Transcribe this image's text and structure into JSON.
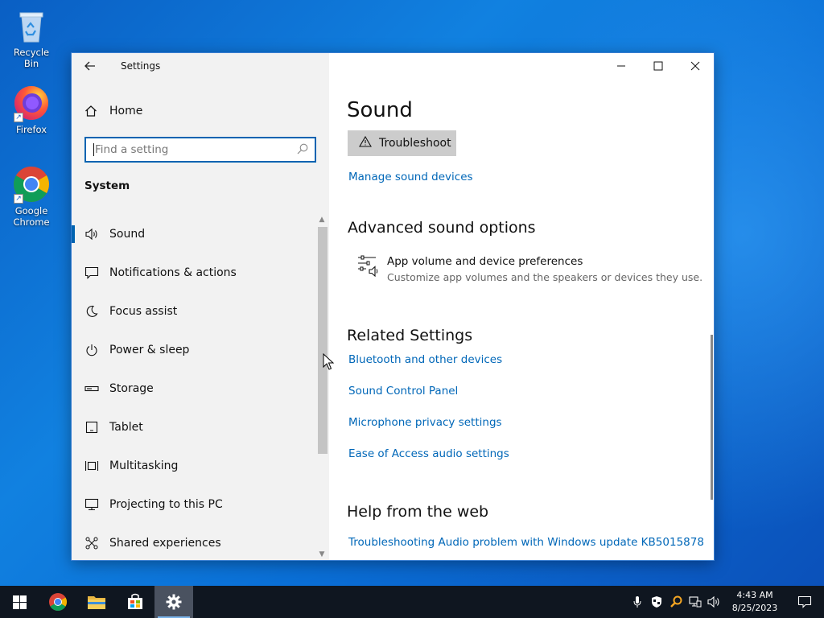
{
  "desktop": {
    "icons": [
      {
        "label": "Recycle Bin",
        "icon": "recycle-bin-icon"
      },
      {
        "label": "Firefox",
        "icon": "firefox-icon"
      },
      {
        "label": "Google Chrome",
        "icon": "chrome-icon"
      }
    ]
  },
  "window": {
    "title": "Settings",
    "controls": {
      "minimize": "minimize-icon",
      "maximize": "maximize-icon",
      "close": "close-icon"
    }
  },
  "sidebar": {
    "home_label": "Home",
    "search_placeholder": "Find a setting",
    "section_label": "System",
    "items": [
      {
        "label": "Sound",
        "icon": "speaker-icon",
        "active": true
      },
      {
        "label": "Notifications & actions",
        "icon": "notification-icon"
      },
      {
        "label": "Focus assist",
        "icon": "moon-icon"
      },
      {
        "label": "Power & sleep",
        "icon": "power-icon"
      },
      {
        "label": "Storage",
        "icon": "storage-icon"
      },
      {
        "label": "Tablet",
        "icon": "tablet-icon"
      },
      {
        "label": "Multitasking",
        "icon": "multitasking-icon"
      },
      {
        "label": "Projecting to this PC",
        "icon": "projecting-icon"
      },
      {
        "label": "Shared experiences",
        "icon": "shared-experiences-icon"
      }
    ]
  },
  "main": {
    "title": "Sound",
    "troubleshoot_label": "Troubleshoot",
    "manage_devices_link": "Manage sound devices",
    "advanced_heading": "Advanced sound options",
    "app_volume": {
      "title": "App volume and device preferences",
      "description": "Customize app volumes and the speakers or devices they use."
    },
    "related_heading": "Related Settings",
    "related_links": [
      "Bluetooth and other devices",
      "Sound Control Panel",
      "Microphone privacy settings",
      "Ease of Access audio settings"
    ],
    "help_heading": "Help from the web",
    "help_links": [
      "Troubleshooting Audio problem with Windows update KB5015878"
    ]
  },
  "taskbar": {
    "apps": [
      {
        "name": "start",
        "icon": "windows-start-icon"
      },
      {
        "name": "chrome",
        "icon": "chrome-icon"
      },
      {
        "name": "file-explorer",
        "icon": "folder-icon"
      },
      {
        "name": "store",
        "icon": "store-icon"
      },
      {
        "name": "settings",
        "icon": "gear-icon",
        "active": true
      }
    ],
    "clock": {
      "time": "4:43 AM",
      "date": "8/25/2023"
    },
    "colors": {
      "taskbar": "#0f1620",
      "accent": "#0063b1",
      "link": "#0067b8"
    }
  }
}
